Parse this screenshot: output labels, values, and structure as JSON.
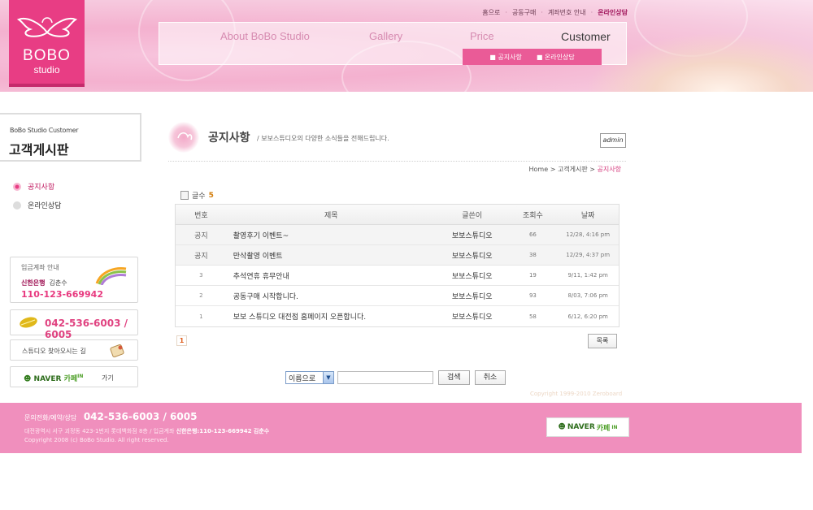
{
  "logo": {
    "line1": "BOBO",
    "line2": "studio"
  },
  "utility_nav": {
    "home": "홈으로",
    "group_buy": "공동구매",
    "account_info": "계좌번호 안내",
    "online_consult": "온라인상담",
    "separator": "·"
  },
  "main_nav": {
    "about": "About BoBo Studio",
    "gallery": "Gallery",
    "price": "Price",
    "customer": "Customer"
  },
  "sub_nav": {
    "notice": "■ 공지사항",
    "online": "■ 온라인상담"
  },
  "sidebar": {
    "subtitle": "BoBo Studio Customer",
    "title": "고객게시판",
    "menu": [
      {
        "label": "공지사항"
      },
      {
        "label": "온라인상담"
      }
    ],
    "account": {
      "title": "입금계좌 안내",
      "bank": "신한은행",
      "owner": "김춘수",
      "number": "110-123-669942"
    },
    "phone": "042-536-6003 / 6005",
    "directions": "스튜디오 찾아오시는 길",
    "cafe": {
      "naver": "NAVER",
      "cafe": "카페",
      "in": "IN",
      "go": "가기"
    }
  },
  "page": {
    "title": "공지사항",
    "description": "/  보보스튜디오의 다양한 소식들을 전해드립니다.",
    "admin": "admin",
    "breadcrumb": {
      "home": "Home",
      "sep": ">",
      "board": "고객게시판",
      "current": "공지사항"
    }
  },
  "board": {
    "count_label": "글수",
    "count": "5",
    "headers": {
      "no": "번호",
      "title": "제목",
      "writer": "글쓴이",
      "views": "조회수",
      "date": "날짜"
    },
    "rows": [
      {
        "no": "공지",
        "title": "촬영후기 이벤트~",
        "writer": "보보스튜디오",
        "views": "66",
        "date": "12/28, 4:16 pm"
      },
      {
        "no": "공지",
        "title": "만삭촬영 이벤트",
        "writer": "보보스튜디오",
        "views": "38",
        "date": "12/29, 4:37 pm"
      },
      {
        "no": "3",
        "title": "추석연휴 휴무안내",
        "writer": "보보스튜디오",
        "views": "19",
        "date": "9/11, 1:42 pm"
      },
      {
        "no": "2",
        "title": "공동구매 시작합니다.",
        "writer": "보보스튜디오",
        "views": "93",
        "date": "8/03, 7:06 pm"
      },
      {
        "no": "1",
        "title": "보보 스튜디오 대전점 홈페이지 오픈합니다.",
        "writer": "보보스튜디오",
        "views": "58",
        "date": "6/12, 6:20 pm"
      }
    ],
    "page": "1",
    "list_button": "목록"
  },
  "search": {
    "select_value": "이름으로",
    "input_value": "",
    "search_button": "검색",
    "cancel_button": "취소"
  },
  "copyright_zb": "Copyright 1999-2010 Zeroboard",
  "footer": {
    "contact_label": "문의전화/예약/상담",
    "contact_phone": "042-536-6003 / 6005",
    "address": "대전광역시 서구 괴정동 423-1번지 롯데백화점 8층 / 입금계좌",
    "account": "신한은행:110-123-669942 김춘수",
    "copyright": "Copyright 2008 (c) BoBo Studio. All right reserved.",
    "cafe": {
      "naver": "NAVER",
      "cafe": "카페",
      "in": "IN"
    }
  },
  "colors": {
    "brand_pink": "#e83d84",
    "footer_pink": "#f08fbd",
    "subnav_pink": "#ea5b97"
  }
}
